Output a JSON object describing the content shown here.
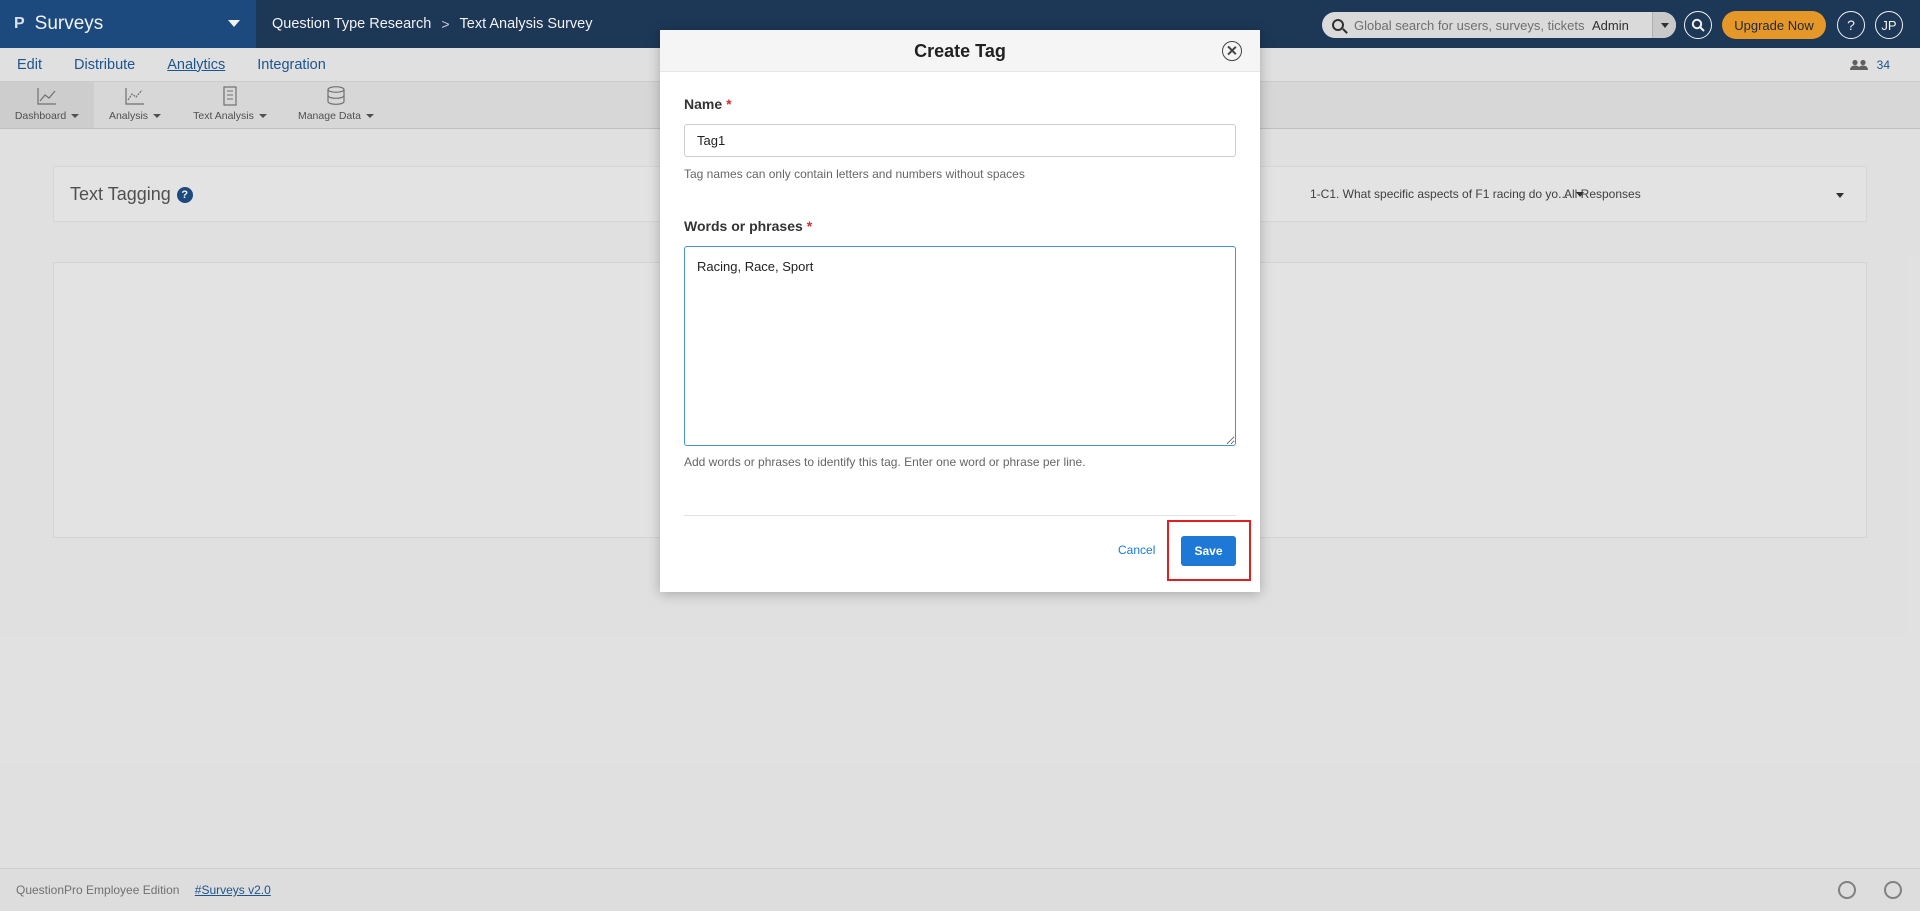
{
  "header": {
    "brand": "Surveys",
    "breadcrumb": [
      "Question Type Research",
      "Text Analysis Survey"
    ],
    "search_placeholder": "Global search for users, surveys, tickets",
    "role": "Admin",
    "upgrade_label": "Upgrade Now",
    "help_label": "?",
    "avatar_initials": "JP"
  },
  "tabs": [
    "Edit",
    "Distribute",
    "Analytics",
    "Integration"
  ],
  "active_tab": "Analytics",
  "users_count": "34",
  "toolbar": [
    "Dashboard",
    "Analysis",
    "Text Analysis",
    "Manage Data"
  ],
  "panel": {
    "title": "Text Tagging",
    "question_select": "1-C1. What specific aspects of F1 racing do yo...",
    "response_select": "All Responses"
  },
  "modal": {
    "title": "Create Tag",
    "name_label": "Name",
    "name_value": "Tag1",
    "name_hint": "Tag names can only contain letters and numbers without spaces",
    "words_label": "Words or phrases",
    "words_value": "Racing, Race, Sport",
    "words_hint": "Add words or phrases to identify this tag. Enter one word or phrase per line.",
    "cancel_label": "Cancel",
    "save_label": "Save",
    "required_mark": "*"
  },
  "footer": {
    "edition": "QuestionPro Employee Edition",
    "version": "#Surveys v2.0"
  },
  "colors": {
    "topbar": "#1f3a5c",
    "brand": "#1e4f86",
    "accent": "#1e78d6",
    "upgrade": "#f2a12b",
    "highlight": "#e02020"
  }
}
